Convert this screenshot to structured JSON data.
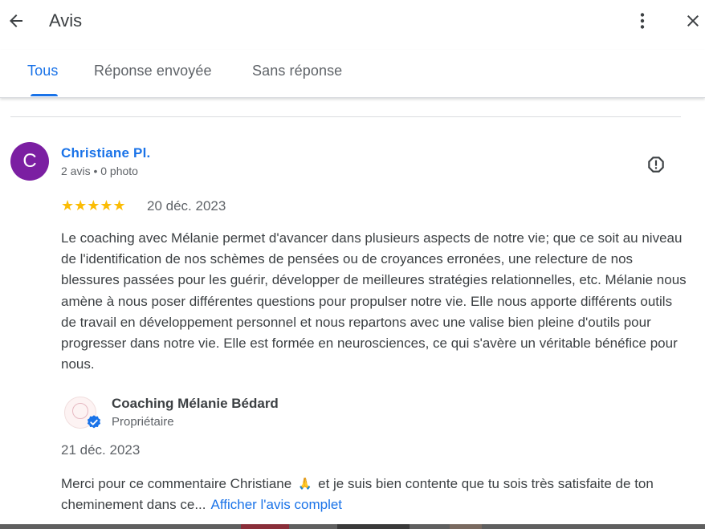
{
  "header": {
    "title": "Avis",
    "back_icon": "arrow-back-icon",
    "more_icon": "more-vert-icon",
    "close_icon": "close-icon"
  },
  "tabs": [
    {
      "label": "Tous",
      "active": true
    },
    {
      "label": "Réponse envoyée",
      "active": false
    },
    {
      "label": "Sans réponse",
      "active": false
    }
  ],
  "review": {
    "avatar_letter": "C",
    "avatar_color": "#7b1fa2",
    "reviewer_name": "Christiane Pl.",
    "reviewer_meta": "2 avis • 0 photo",
    "rating": 5,
    "stars": "★★★★★",
    "date": "20 déc. 2023",
    "text": "Le coaching avec Mélanie permet d'avancer dans plusieurs aspects de notre vie; que ce soit au niveau de l'identification de nos schèmes de pensées ou de croyances erronées, une relecture de nos blessures passées pour les guérir, développer de meilleures stratégies relationnelles, etc. Mélanie nous amène à nous poser différentes questions pour propulser notre vie. Elle nous apporte différents outils de travail en développement personnel et nous repartons avec une valise bien pleine d'outils pour progresser dans notre vie. Elle est formée en neurosciences, ce qui s'avère un véritable bénéfice pour nous.",
    "report_icon": "report-flag-icon"
  },
  "owner_reply": {
    "owner_name": "Coaching Mélanie Bédard",
    "owner_role": "Propriétaire",
    "date": "21 déc. 2023",
    "text_before": "Merci pour ce commentaire Christiane",
    "emoji": "🙏",
    "text_after": "et je suis bien contente que tu sois très satisfaite de ton cheminement dans ce...",
    "more_link": "Afficher l'avis complet"
  },
  "colors": {
    "accent": "#1a73e8",
    "star": "#fbbc04"
  }
}
